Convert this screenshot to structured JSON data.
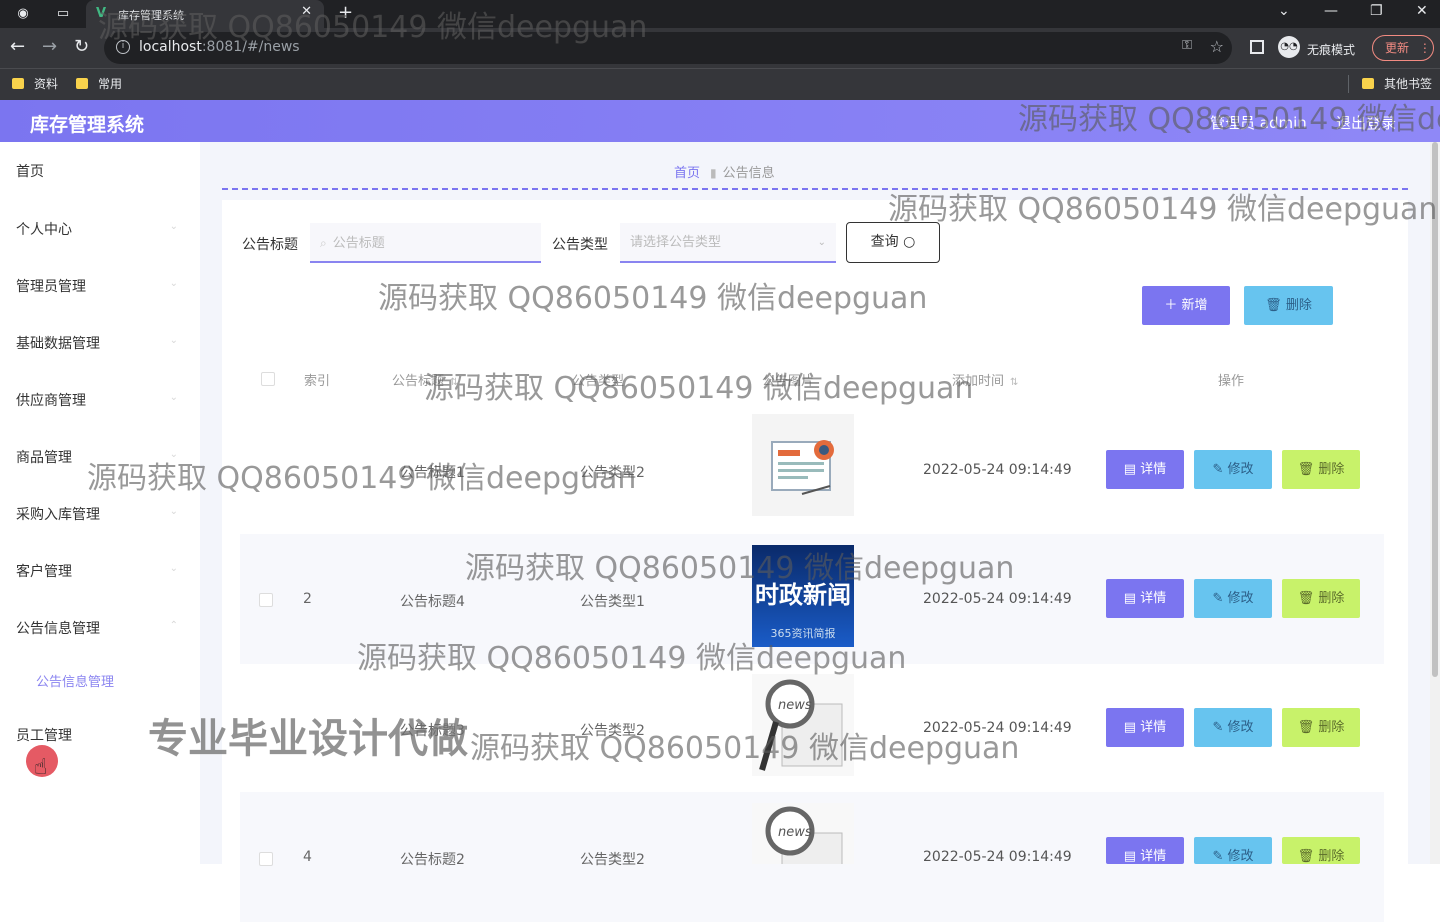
{
  "browser": {
    "tab_title": "库存管理系统",
    "url_host": "localhost",
    "url_rest": ":8081/#/news",
    "incognito_label": "无痕模式",
    "update_label": "更新",
    "bookmarks": [
      "资料",
      "常用"
    ],
    "other_bookmarks": "其他书签"
  },
  "header": {
    "title": "库存管理系统",
    "user": "管理员 admin",
    "logout": "退出登录"
  },
  "sidebar": {
    "items": [
      "首页",
      "个人中心",
      "管理员管理",
      "基础数据管理",
      "供应商管理",
      "商品管理",
      "采购入库管理",
      "客户管理",
      "公告信息管理"
    ],
    "sub_item": "公告信息管理",
    "last_item": "员工管理"
  },
  "breadcrumb": {
    "home": "首页",
    "current": "公告信息"
  },
  "search": {
    "title_label": "公告标题",
    "title_placeholder": "公告标题",
    "type_label": "公告类型",
    "type_placeholder": "请选择公告类型",
    "query_button": "查询"
  },
  "toolbar": {
    "add": "＋ 新增",
    "delete": "删除"
  },
  "table": {
    "headers": {
      "index": "索引",
      "title": "公告标题",
      "type": "公告类型",
      "photo": "公告图片",
      "time": "添加时间",
      "actions": "操作"
    },
    "rows": [
      {
        "index": "1",
        "title": "公告标题1",
        "type": "公告类型2",
        "image": "news-illustration",
        "time": "2022-05-24 09:14:49"
      },
      {
        "index": "2",
        "title": "公告标题4",
        "type": "公告类型1",
        "image": "时政新闻",
        "image_sub": "365资讯简报",
        "time": "2022-05-24 09:14:49"
      },
      {
        "index": "3",
        "title": "公告标题3",
        "type": "公告类型2",
        "image": "news-magnifier",
        "time": "2022-05-24 09:14:49"
      },
      {
        "index": "4",
        "title": "公告标题2",
        "type": "公告类型2",
        "image": "news-magnifier",
        "time": "2022-05-24 09:14:49"
      }
    ],
    "actions": {
      "detail": "详情",
      "edit": "修改",
      "delete": "删除"
    }
  },
  "watermarks": {
    "text": "源码获取 QQ86050149 微信deepguan",
    "banner": "专业毕业设计代做"
  }
}
